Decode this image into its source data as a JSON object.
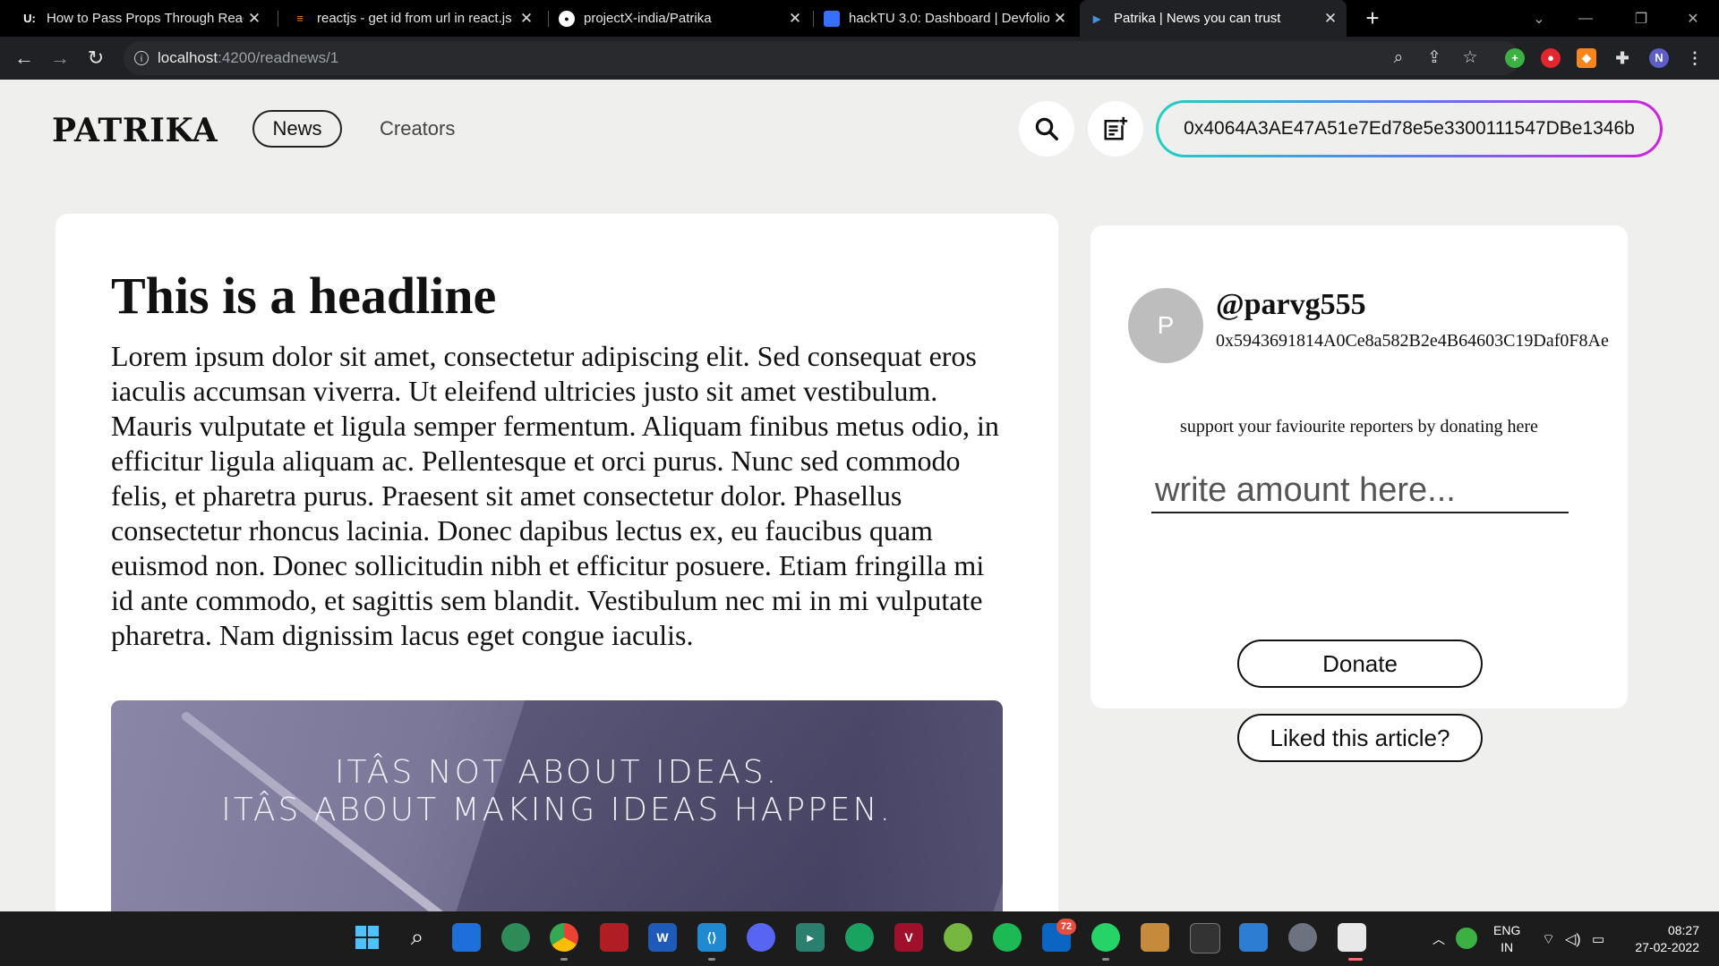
{
  "browser": {
    "tabs": [
      {
        "title": "How to Pass Props Through Reac",
        "favicon": "U:"
      },
      {
        "title": "reactjs - get id from url in react.js",
        "favicon": "so"
      },
      {
        "title": "projectX-india/Patrika",
        "favicon": "gh"
      },
      {
        "title": "hackTU 3.0: Dashboard | Devfolio",
        "favicon": "D"
      },
      {
        "title": "Patrika | News you can trust",
        "favicon": "P",
        "active": true
      }
    ],
    "url_host": "localhost",
    "url_path": ":4200/readnews/1",
    "profile_initial": "N"
  },
  "header": {
    "logo": "PATRIKA",
    "nav": {
      "news": "News",
      "creators": "Creators"
    },
    "wallet_address": "0x4064A3AE47A51e7Ed78e5e3300111547DBe1346b"
  },
  "article": {
    "headline": "This is a headline",
    "body": "Lorem ipsum dolor sit amet, consectetur adipiscing elit. Sed consequat eros iaculis accumsan viverra. Ut eleifend ultricies justo sit amet vestibulum. Mauris vulputate et ligula semper fermentum. Aliquam finibus metus odio, in efficitur ligula aliquam ac. Pellentesque et orci purus. Nunc sed commodo felis, et pharetra purus. Praesent sit amet consectetur dolor. Phasellus consectetur rhoncus lacinia. Donec dapibus lectus ex, eu faucibus quam euismod non. Donec sollicitudin nibh et efficitur posuere. Etiam fringilla mi id ante commodo, et sagittis sem blandit. Vestibulum nec mi in mi vulputate pharetra. Nam dignissim lacus eget congue iaculis.",
    "image_quote_line1": "ITÂS NOT ABOUT IDEAS.",
    "image_quote_line2": "ITÂS ABOUT MAKING IDEAS HAPPEN."
  },
  "creator": {
    "avatar_initial": "P",
    "handle": "@parvg555",
    "address": "0x5943691814A0Ce8a582B2e4B64603C19Daf0F8Ae",
    "support_text": "support your faviourite reporters by donating here",
    "amount_placeholder": "write amount here...",
    "donate_label": "Donate",
    "like_label": "Liked this article?"
  },
  "taskbar": {
    "language": "ENG",
    "region": "IN",
    "time": "08:27",
    "date": "27-02-2022",
    "badge_count": "72"
  },
  "colors": {
    "wallet_gradient": [
      "#1fd1c1",
      "#5a7bf0",
      "#d21fe0"
    ],
    "page_bg": "#efefed"
  }
}
